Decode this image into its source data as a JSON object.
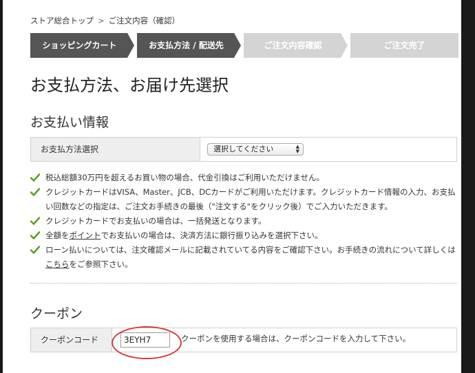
{
  "breadcrumb": {
    "items": [
      "ストア総合トップ",
      "ご注文内容（確認）"
    ],
    "separator": ">"
  },
  "steps": [
    {
      "label": "ショッピングカート",
      "state": "done"
    },
    {
      "label": "お支払方法 / 配送先",
      "state": "current"
    },
    {
      "label": "ご注文内容確認",
      "state": "upcoming"
    },
    {
      "label": "ご注文完了",
      "state": "upcoming"
    }
  ],
  "page_title": "お支払方法、お届け先選択",
  "payment": {
    "section_title": "お支払い情報",
    "method_label": "お支払方法選択",
    "select_value": "選択してください"
  },
  "notes": [
    {
      "text": "税込総額30万円を超えるお買い物の場合、代金引換はご利用いただけません。"
    },
    {
      "text": "クレジットカードはVISA、Master、JCB、DCカードがご利用いただけます。クレジットカード情報の入力、お支払い回数などの指定は、ご注文お手続きの最後（\"注文する\"をクリック後）でご入力いただきます。"
    },
    {
      "text": "クレジットカードでお支払いの場合は、一括発送となります。"
    },
    {
      "pre": "全額を",
      "link": "ポイント",
      "post": "でお支払いの場合は、決済方法に銀行振り込みを選択下さい。"
    },
    {
      "pre": "ローン払いについては、注文確認メールに記載されていてる内容をご確認下さい。お手続きの流れについて詳しくは",
      "link": "こちら",
      "post": "をご参照下さい。"
    }
  ],
  "coupon": {
    "section_title": "クーポン",
    "label": "クーポンコード",
    "value": "3EYH7",
    "hint": "クーポンを使用する場合は、クーポンコードを入力して下さい。"
  },
  "colors": {
    "step_active": "#555555",
    "step_inactive": "#d4d4d4",
    "check_green": "#5aa028",
    "highlight": "#d73a3a"
  },
  "icons": {
    "note_icon": "check-icon",
    "select_icon": "updown-arrows-icon"
  }
}
